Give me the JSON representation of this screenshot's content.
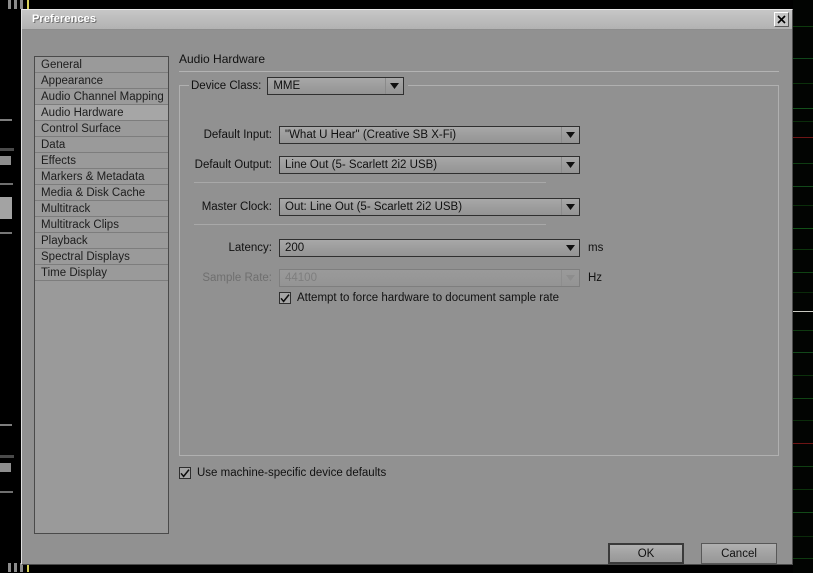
{
  "window": {
    "title": "Preferences",
    "close_icon": "close-x-icon"
  },
  "sidebar": {
    "items": [
      {
        "label": "General",
        "selected": false
      },
      {
        "label": "Appearance",
        "selected": false
      },
      {
        "label": "Audio Channel Mapping",
        "selected": false
      },
      {
        "label": "Audio Hardware",
        "selected": true
      },
      {
        "label": "Control Surface",
        "selected": false
      },
      {
        "label": "Data",
        "selected": false
      },
      {
        "label": "Effects",
        "selected": false
      },
      {
        "label": "Markers & Metadata",
        "selected": false
      },
      {
        "label": "Media & Disk Cache",
        "selected": false
      },
      {
        "label": "Multitrack",
        "selected": false
      },
      {
        "label": "Multitrack Clips",
        "selected": false
      },
      {
        "label": "Playback",
        "selected": false
      },
      {
        "label": "Spectral Displays",
        "selected": false
      },
      {
        "label": "Time Display",
        "selected": false
      }
    ]
  },
  "pane": {
    "title": "Audio Hardware",
    "group": {
      "legend_label": "Device Class:",
      "device_class_value": "MME",
      "rows": [
        {
          "label": "Default Input:",
          "value": "\"What U Hear\" (Creative SB X-Fi)",
          "unit": "",
          "disabled": false
        },
        {
          "label": "Default Output:",
          "value": "Line Out (5- Scarlett 2i2 USB)",
          "unit": "",
          "disabled": false
        },
        {
          "label": "Master Clock:",
          "value": "Out: Line Out (5- Scarlett 2i2 USB)",
          "unit": "",
          "disabled": false
        },
        {
          "label": "Latency:",
          "value": "200",
          "unit": "ms",
          "disabled": false
        },
        {
          "label": "Sample Rate:",
          "value": "44100",
          "unit": "Hz",
          "disabled": true
        }
      ],
      "force_sample_rate": {
        "label": "Attempt to force hardware to document sample rate",
        "checked": true
      }
    },
    "machine_defaults": {
      "label": "Use machine-specific device defaults",
      "checked": true
    }
  },
  "footer": {
    "ok_label": "OK",
    "cancel_label": "Cancel"
  },
  "colors": {
    "dialog_background": "#919191",
    "titlebar": "#bdbdbd",
    "field_background": "#9d9d9d",
    "selected_item": "#a6a6a6",
    "text": "#111111",
    "disabled_text": "#7e7e7e",
    "backdrop": "#000000"
  }
}
